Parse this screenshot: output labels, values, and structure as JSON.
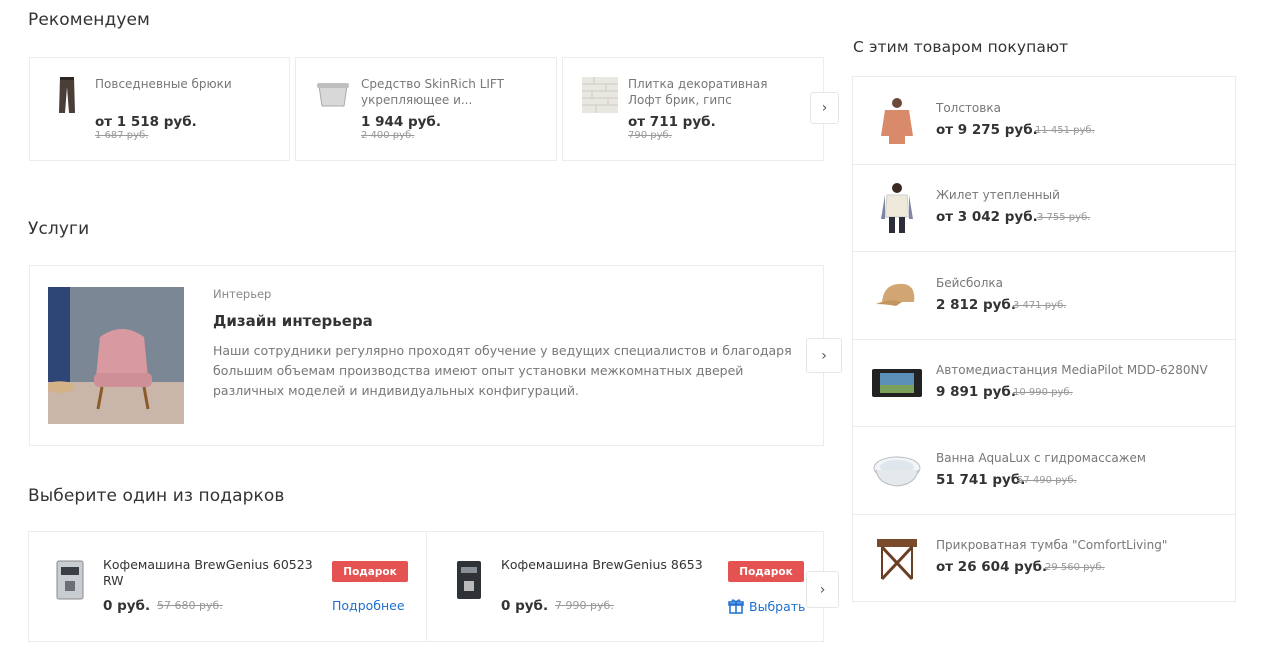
{
  "recommended": {
    "title": "Рекомендуем",
    "items": [
      {
        "name": "Повседневные брюки",
        "price": "от 1 518 руб.",
        "old_price": "1 687 руб."
      },
      {
        "name": "Средство SkinRich LIFT укрепляющее и...",
        "price": "1 944 руб.",
        "old_price": "2 400 руб."
      },
      {
        "name": "Плитка декоративная Лофт брик, гипс",
        "price": "от 711 руб.",
        "old_price": "790 руб."
      }
    ],
    "next_icon": "chevron-right-icon"
  },
  "services": {
    "title": "Услуги",
    "card": {
      "category": "Интерьер",
      "title": "Дизайн интерьера",
      "description": "Наши сотрудники регулярно проходят обучение у ведущих специалистов и благодаря большим объемам производства имеют опыт установки межкомнатных дверей различных моделей и индивидуальных конфигураций."
    }
  },
  "gifts": {
    "title": "Выберите один из подарков",
    "items": [
      {
        "name": "Кофемашина BrewGenius 60523 RW",
        "price": "0 руб.",
        "old_price": "57 680 руб.",
        "badge": "Подарок",
        "link": "Подробнее"
      },
      {
        "name": "Кофемашина BrewGenius 8653",
        "price": "0 руб.",
        "old_price": "7 990 руб.",
        "badge": "Подарок",
        "link": "Выбрать"
      }
    ],
    "colors": {
      "badge": "#e45252",
      "link": "#1f6fd1"
    }
  },
  "also_bought": {
    "title": "С этим товаром покупают",
    "items": [
      {
        "name": "Толстовка",
        "price": "от 9 275 руб.",
        "old_price": "11 451 руб."
      },
      {
        "name": "Жилет утепленный",
        "price": "от 3 042 руб.",
        "old_price": "3 755 руб."
      },
      {
        "name": "Бейсболка",
        "price": "2 812 руб.",
        "old_price": "3 471 руб."
      },
      {
        "name": "Автомедиастанция MediaPilot MDD-6280NV",
        "price": "9 891 руб.",
        "old_price": "10 990 руб."
      },
      {
        "name": "Ванна AquaLux с гидромассажем",
        "price": "51 741 руб.",
        "old_price": "57 490 руб."
      },
      {
        "name": "Прикроватная тумба \"ComfortLiving\"",
        "price": "от 26 604 руб.",
        "old_price": "29 560 руб."
      }
    ]
  }
}
